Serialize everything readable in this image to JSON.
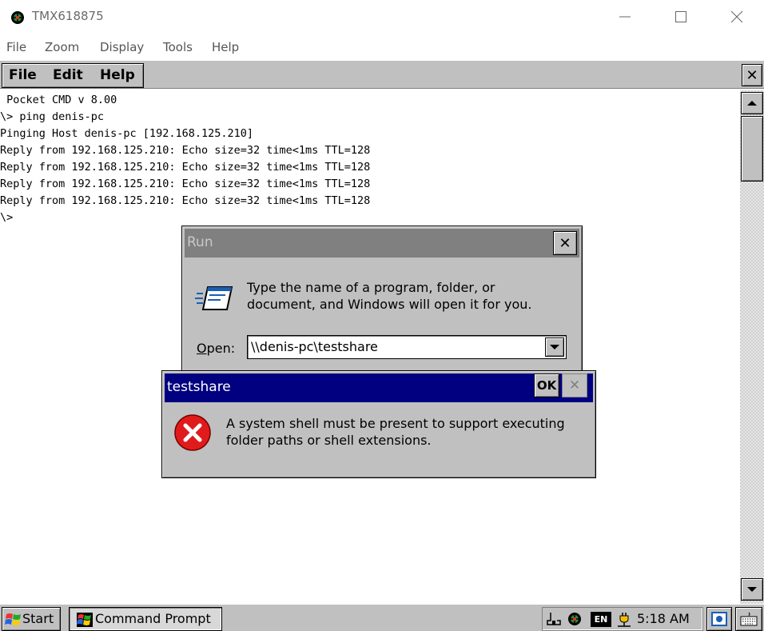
{
  "host_window": {
    "title": "TMX618875",
    "menu": [
      "File",
      "Zoom",
      "Display",
      "Tools",
      "Help"
    ]
  },
  "ce_app": {
    "menu": [
      "File",
      "Edit",
      "Help"
    ],
    "close_symbol": "✕"
  },
  "console": {
    "lines": [
      " Pocket CMD v 8.00",
      "\\> ping denis-pc",
      "Pinging Host denis-pc [192.168.125.210]",
      "Reply from 192.168.125.210: Echo size=32 time<1ms TTL=128",
      "Reply from 192.168.125.210: Echo size=32 time<1ms TTL=128",
      "Reply from 192.168.125.210: Echo size=32 time<1ms TTL=128",
      "Reply from 192.168.125.210: Echo size=32 time<1ms TTL=128",
      "\\>"
    ]
  },
  "run_dialog": {
    "title": "Run",
    "prompt": "Type the name of a program, folder, or document, and Windows will open it for you.",
    "open_label_accel": "O",
    "open_label_rest": "pen:",
    "open_value": "\\\\denis-pc\\testshare",
    "close_symbol": "✕"
  },
  "error_dialog": {
    "title": "testshare",
    "ok_label": "OK",
    "close_symbol": "✕",
    "message": "A system shell must be present to support executing folder paths or shell extensions."
  },
  "taskbar": {
    "start_label": "Start",
    "task_label": "Command Prompt",
    "language": "EN",
    "time": "5:18 AM"
  },
  "icons": {
    "host_app": "bug-icon",
    "run": "run-icon",
    "error": "error-icon",
    "start": "windows-flag-icon",
    "task": "command-prompt-icon"
  },
  "colors": {
    "ce_face": "#c0c0c0",
    "active_title": "#000080",
    "inactive_title": "#808080",
    "error_red": "#e01b1b"
  }
}
